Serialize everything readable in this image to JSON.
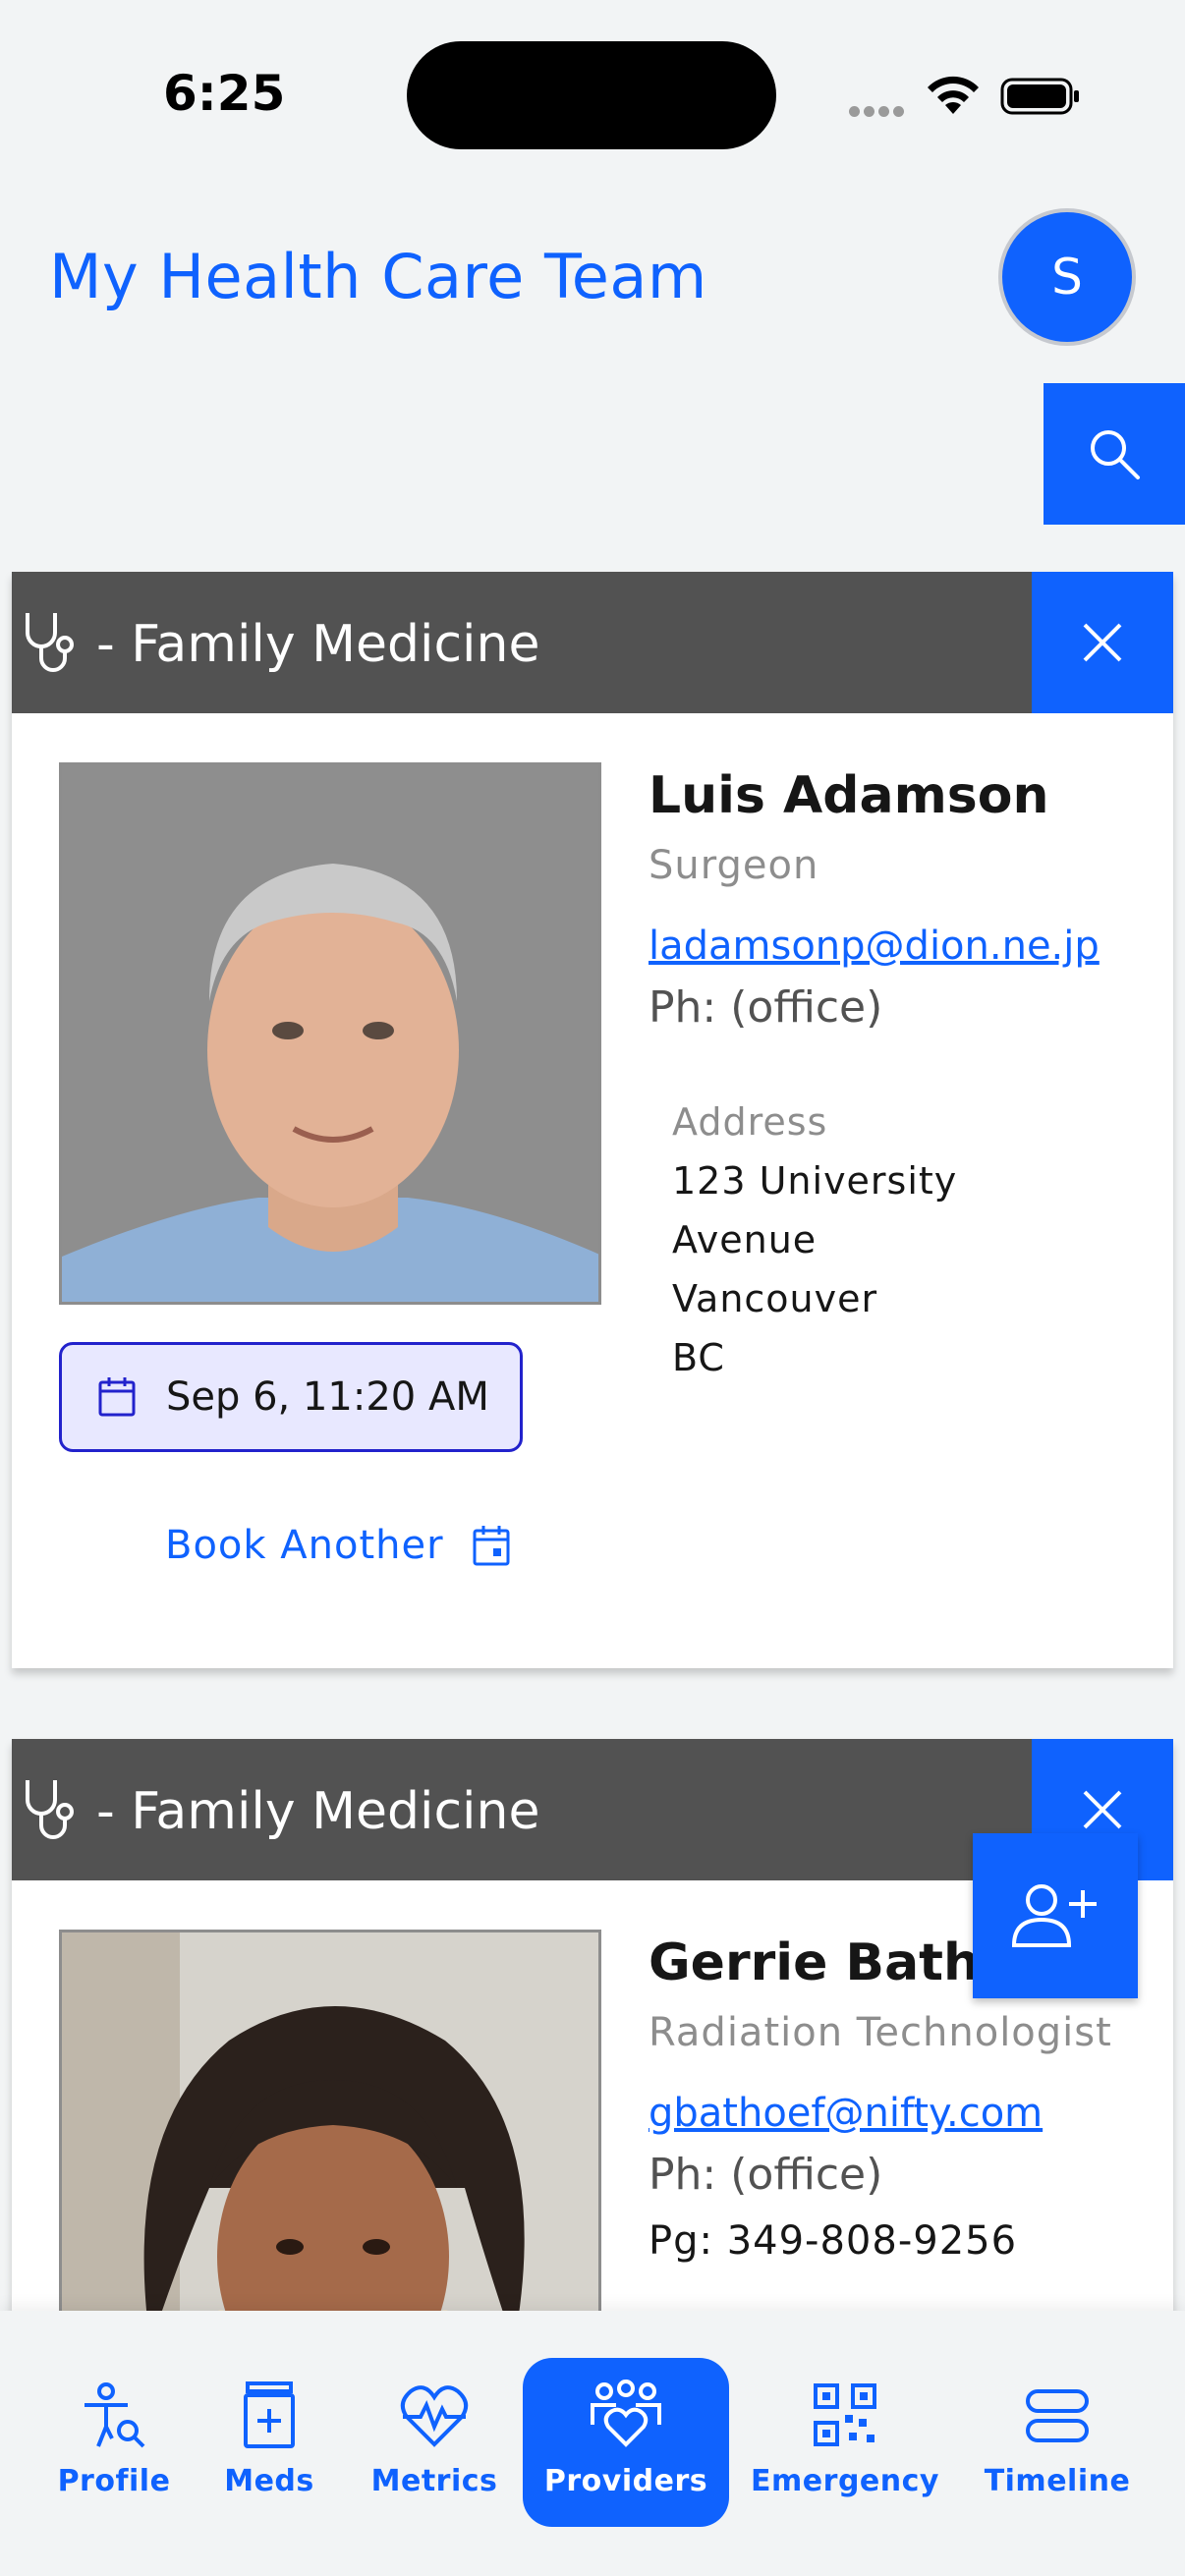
{
  "status_bar": {
    "time": "6:25"
  },
  "header": {
    "title": "My Health Care Team",
    "avatar_initial": "S"
  },
  "providers": [
    {
      "specialty": "- Family Medicine",
      "name": "Luis Adamson",
      "role": "Surgeon",
      "email": "ladamsonp@dion.ne.jp",
      "phone": "Ph: (office)",
      "address_label": "Address",
      "address_lines": [
        "123 University",
        "Avenue",
        "Vancouver",
        "BC"
      ],
      "appointment": "Sep 6, 11:20 AM",
      "book_another": "Book Another"
    },
    {
      "specialty": "- Family Medicine",
      "name": "Gerrie Bathoe",
      "role": "Radiation Technologist",
      "email": "gbathoef@nifty.com",
      "phone": "Ph: (office)",
      "pager": "Pg: 349-808-9256"
    }
  ],
  "bottom_nav": {
    "items": [
      {
        "label": "Profile",
        "icon": "profile-search-icon"
      },
      {
        "label": "Meds",
        "icon": "medication-icon"
      },
      {
        "label": "Metrics",
        "icon": "heart-pulse-icon"
      },
      {
        "label": "Providers",
        "icon": "group-heart-icon",
        "active": true
      },
      {
        "label": "Emergency",
        "icon": "qr-code-icon"
      },
      {
        "label": "Timeline",
        "icon": "timeline-icon"
      }
    ]
  },
  "colors": {
    "accent": "#0f62fe",
    "card_header": "#525252",
    "chip_bg": "#e8e8ff"
  }
}
